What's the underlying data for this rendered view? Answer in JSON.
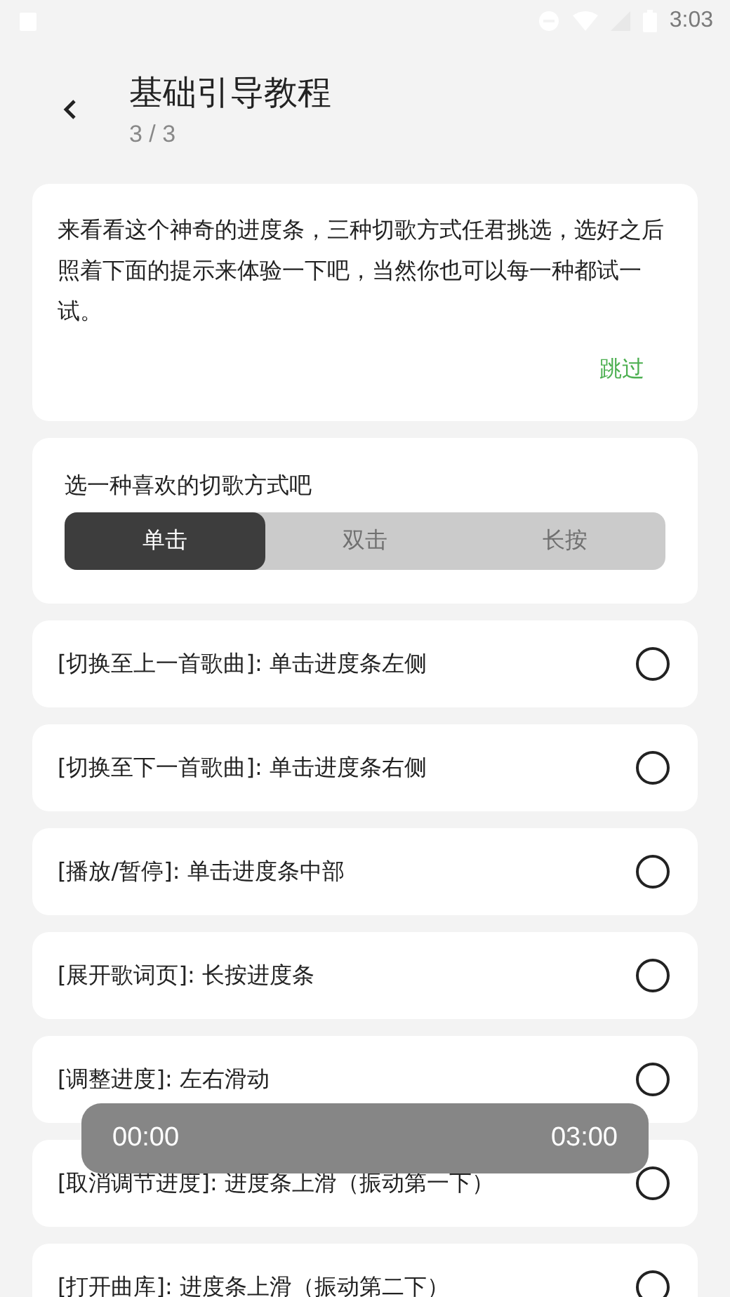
{
  "status_bar": {
    "time": "3:03"
  },
  "header": {
    "title": "基础引导教程",
    "step": "3 / 3"
  },
  "intro": {
    "text": "来看看这个神奇的进度条，三种切歌方式任君挑选，选好之后照着下面的提示来体验一下吧，当然你也可以每一种都试一试。",
    "skip": "跳过"
  },
  "mode_picker": {
    "label": "选一种喜欢的切歌方式吧",
    "options": [
      {
        "label": "单击",
        "selected": true
      },
      {
        "label": "双击",
        "selected": false
      },
      {
        "label": "长按",
        "selected": false
      }
    ]
  },
  "steps": [
    {
      "text": "[切换至上一首歌曲]: 单击进度条左侧",
      "checked": false
    },
    {
      "text": "[切换至下一首歌曲]: 单击进度条右侧",
      "checked": false
    },
    {
      "text": "[播放/暂停]: 单击进度条中部",
      "checked": false
    },
    {
      "text": "[展开歌词页]: 长按进度条",
      "checked": false
    },
    {
      "text": "[调整进度]: 左右滑动",
      "checked": false
    },
    {
      "text": "[取消调节进度]: 进度条上滑（振动第一下）",
      "checked": false
    },
    {
      "text": "[打开曲库]: 进度条上滑（振动第二下）",
      "checked": false
    }
  ],
  "progress_overlay": {
    "start": "00:00",
    "end": "03:00"
  }
}
